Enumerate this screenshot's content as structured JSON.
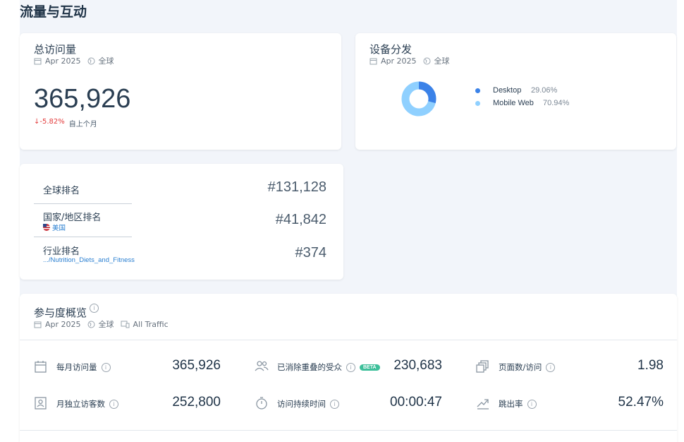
{
  "page": {
    "title": "流量与互动"
  },
  "visits_card": {
    "title": "总访问量",
    "date": "Apr 2025",
    "region": "全球",
    "value": "365,926",
    "change": "↓-5.82%",
    "change_label": "自上个月"
  },
  "device_card": {
    "title": "设备分发",
    "date": "Apr 2025",
    "region": "全球",
    "items": [
      {
        "label": "Desktop",
        "pct": "29.06%",
        "value": 29.06,
        "color": "#3b82e8"
      },
      {
        "label": "Mobile Web",
        "pct": "70.94%",
        "value": 70.94,
        "color": "#8fd0ff"
      }
    ]
  },
  "rank_card": {
    "rows": [
      {
        "label": "全球排名",
        "sub": "",
        "value": "#131,128"
      },
      {
        "label": "国家/地区排名",
        "sub": "美国",
        "value": "#41,842"
      },
      {
        "label": "行业排名",
        "sub": ".../Nutrition_Diets_and_Fitness",
        "value": "#374"
      }
    ]
  },
  "engagement": {
    "title": "参与度概览",
    "date": "Apr 2025",
    "region": "全球",
    "traffic": "All Traffic",
    "beta": "BETA",
    "metrics": [
      {
        "label": "每月访问量",
        "value": "365,926",
        "icon": "calendar-icon"
      },
      {
        "label": "已消除重叠的受众",
        "value": "230,683",
        "icon": "people-icon"
      },
      {
        "label": "页面数/访问",
        "value": "1.98",
        "icon": "pages-icon"
      },
      {
        "label": "月独立访客数",
        "value": "252,800",
        "icon": "id-card-icon"
      },
      {
        "label": "访问持续时间",
        "value": "00:00:47",
        "icon": "stopwatch-icon"
      },
      {
        "label": "跳出率",
        "value": "52.47%",
        "icon": "trend-up-icon"
      }
    ]
  }
}
